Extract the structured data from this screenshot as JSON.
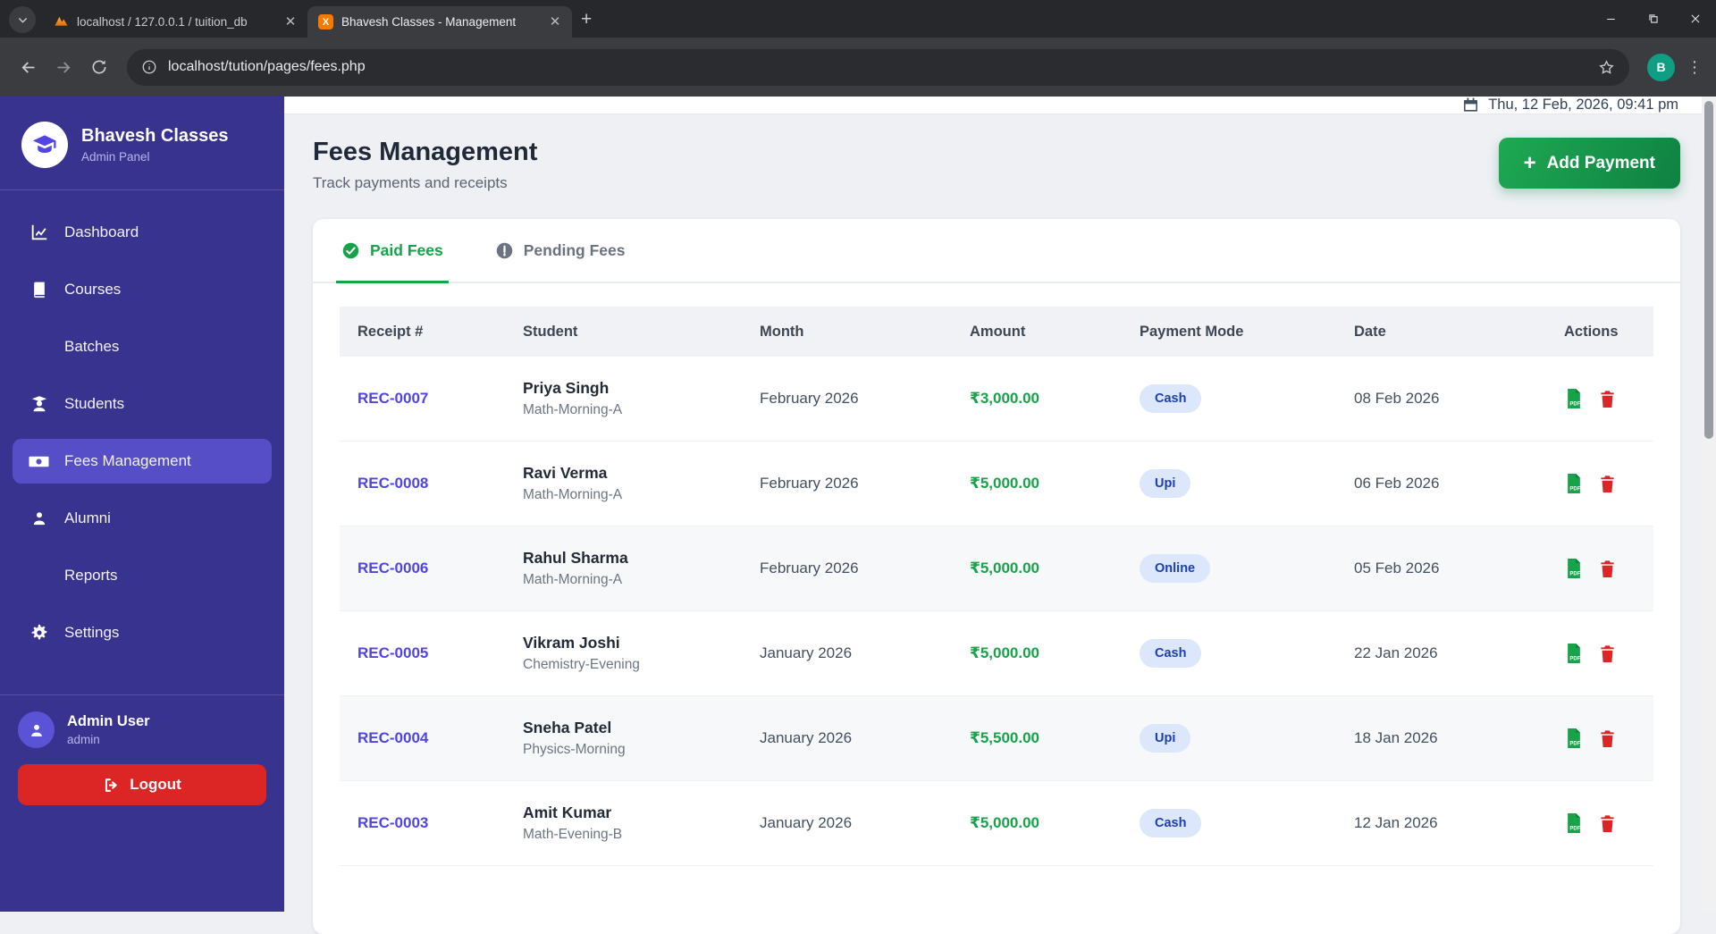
{
  "browser": {
    "tabs": [
      {
        "title": "localhost / 127.0.0.1 / tuition_db",
        "favicon": "phpmyadmin-icon",
        "active": false
      },
      {
        "title": "Bhavesh Classes - Management",
        "favicon": "xampp-icon",
        "favicon_letter": "X",
        "active": true
      }
    ],
    "url": "localhost/tution/pages/fees.php",
    "profile_initial": "B"
  },
  "sidebar": {
    "brand": {
      "title": "Bhavesh Classes",
      "subtitle": "Admin Panel"
    },
    "items": [
      {
        "label": "Dashboard"
      },
      {
        "label": "Courses"
      },
      {
        "label": "Batches"
      },
      {
        "label": "Students"
      },
      {
        "label": "Fees Management"
      },
      {
        "label": "Alumni"
      },
      {
        "label": "Reports"
      },
      {
        "label": "Settings"
      }
    ],
    "user": {
      "name": "Admin User",
      "role": "admin"
    },
    "logout_label": "Logout"
  },
  "topbar": {
    "datetime": "Thu, 12 Feb, 2026, 09:41 pm"
  },
  "page": {
    "title": "Fees Management",
    "subtitle": "Track payments and receipts",
    "add_payment_label": "Add Payment"
  },
  "fee_tabs": [
    {
      "label": "Paid Fees",
      "active": true
    },
    {
      "label": "Pending Fees",
      "active": false
    }
  ],
  "table": {
    "columns": [
      "Receipt #",
      "Student",
      "Month",
      "Amount",
      "Payment Mode",
      "Date",
      "Actions"
    ],
    "rows": [
      {
        "receipt": "REC-0007",
        "student": "Priya Singh",
        "batch": "Math-Morning-A",
        "month": "February 2026",
        "amount": "₹3,000.00",
        "mode": "Cash",
        "date": "08 Feb 2026"
      },
      {
        "receipt": "REC-0008",
        "student": "Ravi Verma",
        "batch": "Math-Morning-A",
        "month": "February 2026",
        "amount": "₹5,000.00",
        "mode": "Upi",
        "date": "06 Feb 2026"
      },
      {
        "receipt": "REC-0006",
        "student": "Rahul Sharma",
        "batch": "Math-Morning-A",
        "month": "February 2026",
        "amount": "₹5,000.00",
        "mode": "Online",
        "date": "05 Feb 2026"
      },
      {
        "receipt": "REC-0005",
        "student": "Vikram Joshi",
        "batch": "Chemistry-Evening",
        "month": "January 2026",
        "amount": "₹5,000.00",
        "mode": "Cash",
        "date": "22 Jan 2026"
      },
      {
        "receipt": "REC-0004",
        "student": "Sneha Patel",
        "batch": "Physics-Morning",
        "month": "January 2026",
        "amount": "₹5,500.00",
        "mode": "Upi",
        "date": "18 Jan 2026"
      },
      {
        "receipt": "REC-0003",
        "student": "Amit Kumar",
        "batch": "Math-Evening-B",
        "month": "January 2026",
        "amount": "₹5,000.00",
        "mode": "Cash",
        "date": "12 Jan 2026"
      }
    ]
  },
  "icon_labels": {
    "pdf": "PDF"
  },
  "colors": {
    "sidebar_bg": "#38338f",
    "sidebar_active": "#554ec6",
    "logout_red": "#dc2626",
    "accent_green": "#16a34a",
    "receipt_link": "#5044e4",
    "badge_bg": "#dce7fc",
    "badge_text": "#1e40af",
    "trash_red": "#dc2626"
  }
}
